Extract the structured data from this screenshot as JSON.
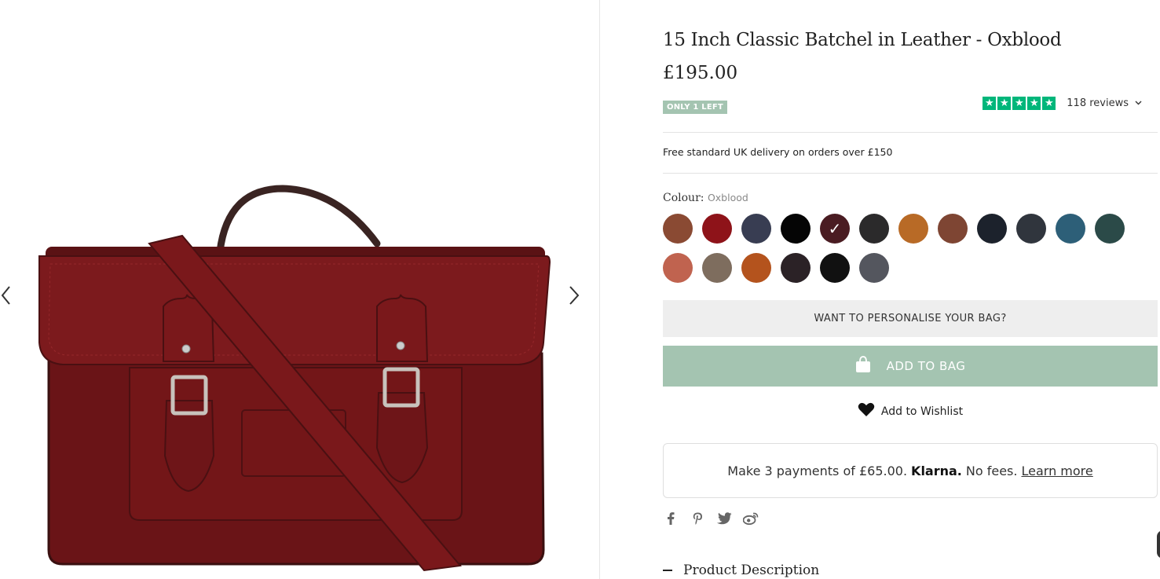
{
  "product": {
    "title": "15 Inch Classic Batchel in Leather - Oxblood",
    "price": "£195.00",
    "stock_badge": "ONLY 1 LEFT",
    "reviews_count": "118 reviews",
    "rating_stars": 5
  },
  "delivery": "Free standard UK delivery on orders over £150",
  "colour": {
    "label": "Colour:",
    "selected": "Oxblood",
    "swatches": [
      {
        "color": "#8a4a33"
      },
      {
        "color": "#8e1319"
      },
      {
        "color": "#383d52"
      },
      {
        "color": "#050505"
      },
      {
        "color": "#4a1c22",
        "selected": true
      },
      {
        "color": "#2b2a2b"
      },
      {
        "color": "#b86a26"
      },
      {
        "color": "#7e4533"
      },
      {
        "color": "#1c222c"
      },
      {
        "color": "#30353d"
      },
      {
        "color": "#2d5f78"
      },
      {
        "color": "#2b4a48"
      },
      {
        "color": "#c0634f"
      },
      {
        "color": "#7e6d5e"
      },
      {
        "color": "#b4531d"
      },
      {
        "color": "#2b2226"
      },
      {
        "color": "#111111"
      },
      {
        "color": "#54565e"
      }
    ]
  },
  "actions": {
    "personalise": "WANT TO PERSONALISE YOUR BAG?",
    "add_to_bag": "ADD TO BAG",
    "wishlist": "Add to Wishlist"
  },
  "klarna": {
    "text": "Make 3 payments of £65.00.",
    "brand": "Klarna.",
    "fees": "No fees.",
    "learn_more": "Learn more"
  },
  "sections": {
    "product_description": "Product Description"
  },
  "colors": {
    "accent_green": "#a4c4b1",
    "trustpilot_green": "#00b67a",
    "bag_oxblood": "#6e1518"
  }
}
